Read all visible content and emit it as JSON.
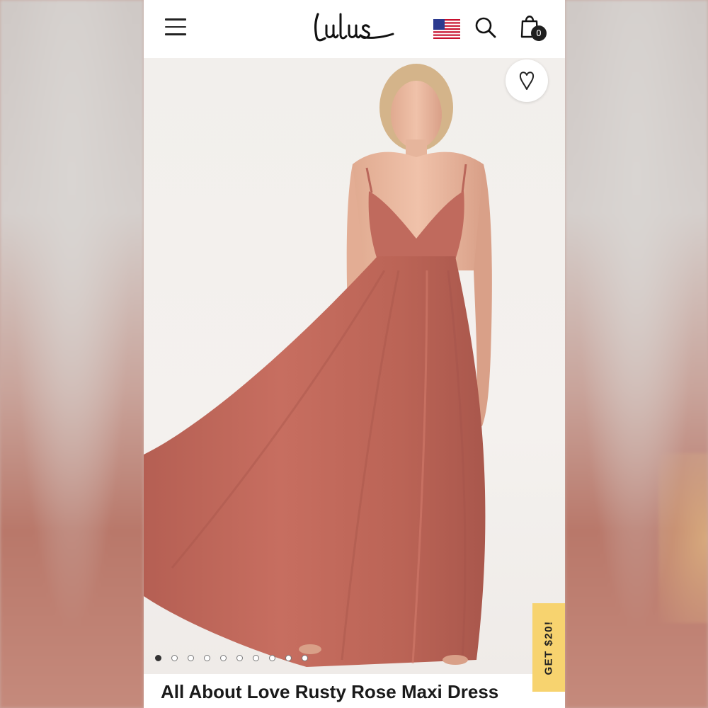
{
  "header": {
    "brand": "Lulus",
    "cart_count": "0"
  },
  "icons": {
    "menu": "hamburger-menu-icon",
    "flag": "us-flag-icon",
    "search": "search-icon",
    "cart": "shopping-bag-icon",
    "wishlist": "heart-icon"
  },
  "gallery": {
    "image_count": 10,
    "active_index": 0
  },
  "promo": {
    "label": "GET $20!"
  },
  "product": {
    "title": "All About Love Rusty Rose Maxi Dress"
  },
  "colors": {
    "dress": "#c0695c",
    "promo": "#f7d36f",
    "badge": "#1f1f1f"
  }
}
